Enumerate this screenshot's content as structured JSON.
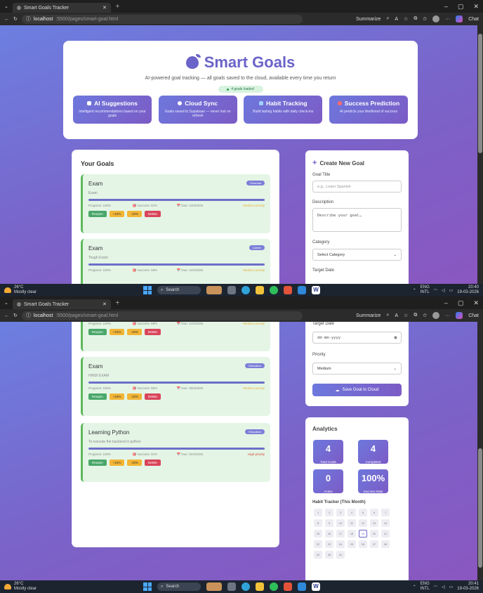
{
  "browser": {
    "tab_title": "Smart Goals Tracker",
    "url_host": "localhost",
    "url_path": ":5500/pages/smart-goal.html",
    "summarize_label": "Summarize",
    "chat_label": "Chat"
  },
  "taskbar": {
    "temp": "26°C",
    "weather": "Mostly clear",
    "search": "Search",
    "lang1": "ENG",
    "lang2": "INTL",
    "time_top": "20:40",
    "time_bottom": "20:41",
    "date": "19-03-2026"
  },
  "header": {
    "title": "Smart Goals",
    "subtitle": "AI-powered goal tracking — all goals saved to the cloud, available every time you return",
    "loaded_badge": "4 goals loaded"
  },
  "features": [
    {
      "title": "AI Suggestions",
      "desc": "Intelligent recommendations based on your goals",
      "icon_color": "#ffffff"
    },
    {
      "title": "Cloud Sync",
      "desc": "Goals saved to Supabase — never lost on refresh",
      "icon_color": "#ffffff"
    },
    {
      "title": "Habit Tracking",
      "desc": "Build lasting habits with daily check-ins",
      "icon_color": "#9fd0ff"
    },
    {
      "title": "Success Prediction",
      "desc": "AI predicts your likelihood of success",
      "icon_color": "#ff6b6b"
    }
  ],
  "goals_title": "Your Goals",
  "goals": [
    {
      "name": "Exam",
      "desc": "Exam",
      "tag": "Personal",
      "progress": "Progress: 100%",
      "success": "Success: 62%",
      "due": "Due: 12/3/2026",
      "priority": "Medium priority",
      "progress_value": 1.0
    },
    {
      "name": "Exam",
      "desc": "Tough Exam",
      "tag": "Career",
      "progress": "Progress: 100%",
      "success": "Success: 68%",
      "due": "Due: 12/3/2026",
      "priority": "Medium priority",
      "progress_value": 1.0
    },
    {
      "name": "Exam",
      "desc": "HINDI EXAM",
      "tag": "Education",
      "progress": "Progress: 100%",
      "success": "Success: 85%",
      "due": "Due: 26/3/2026",
      "priority": "Medium priority",
      "progress_value": 1.0
    },
    {
      "name": "Learning Python",
      "desc": "To execute the backend in python",
      "tag": "Education",
      "progress": "Progress: 100%",
      "success": "Success: 91%",
      "due": "Due: 31/3/2026",
      "priority": "High priority",
      "progress_value": 1.0
    }
  ],
  "goal_buttons": {
    "reopen": "Reopen",
    "plus": "+10%",
    "minus": "-10%",
    "delete": "Delete"
  },
  "form": {
    "title": "Create New Goal",
    "goal_title_label": "Goal Title",
    "goal_title_placeholder": "e.g., Learn Spanish",
    "description_label": "Description",
    "description_placeholder": "Describe your goal…",
    "category_label": "Category",
    "category_value": "Select Category",
    "target_date_label": "Target Date",
    "target_date_value": "dd-mm-yyyy",
    "priority_label": "Priority",
    "priority_value": "Medium",
    "save_label": "Save Goal to Cloud"
  },
  "analytics": {
    "title": "Analytics",
    "stats": [
      {
        "value": "4",
        "label": "Total Goals"
      },
      {
        "value": "4",
        "label": "Completed"
      },
      {
        "value": "0",
        "label": "Active"
      },
      {
        "value": "100%",
        "label": "Success Rate"
      }
    ],
    "habit_title": "Habit Tracker (This Month)",
    "days": [
      "1",
      "2",
      "3",
      "4",
      "5",
      "6",
      "7",
      "8",
      "9",
      "10",
      "11",
      "12",
      "13",
      "14",
      "15",
      "16",
      "17",
      "18",
      "19",
      "20",
      "21",
      "22",
      "23",
      "24",
      "25",
      "26",
      "27",
      "28",
      "29",
      "30",
      "31"
    ],
    "today": "19"
  }
}
